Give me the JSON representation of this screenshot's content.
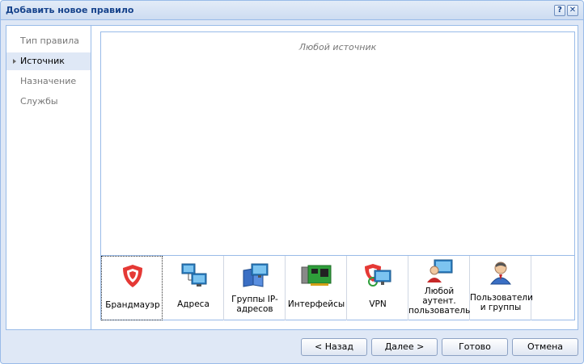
{
  "window": {
    "title": "Добавить новое правило",
    "help_glyph": "?",
    "close_glyph": "✕"
  },
  "nav": {
    "items": [
      {
        "label": "Тип правила",
        "active": false
      },
      {
        "label": "Источник",
        "active": true
      },
      {
        "label": "Назначение",
        "active": false
      },
      {
        "label": "Службы",
        "active": false
      }
    ]
  },
  "content": {
    "empty_text": "Любой источник"
  },
  "tiles": [
    {
      "label": "Брандмауэр",
      "icon": "shield-icon"
    },
    {
      "label": "Адреса",
      "icon": "network-computers-icon"
    },
    {
      "label": "Группы IP-адресов",
      "icon": "ip-group-icon"
    },
    {
      "label": "Интерфейсы",
      "icon": "network-card-icon"
    },
    {
      "label": "VPN",
      "icon": "vpn-icon"
    },
    {
      "label": "Любой аутент. пользователь",
      "icon": "user-computer-icon"
    },
    {
      "label": "Пользователи и группы",
      "icon": "user-icon"
    }
  ],
  "footer": {
    "back_label": "< Назад",
    "next_label": "Далее >",
    "done_label": "Готово",
    "cancel_label": "Отмена"
  }
}
